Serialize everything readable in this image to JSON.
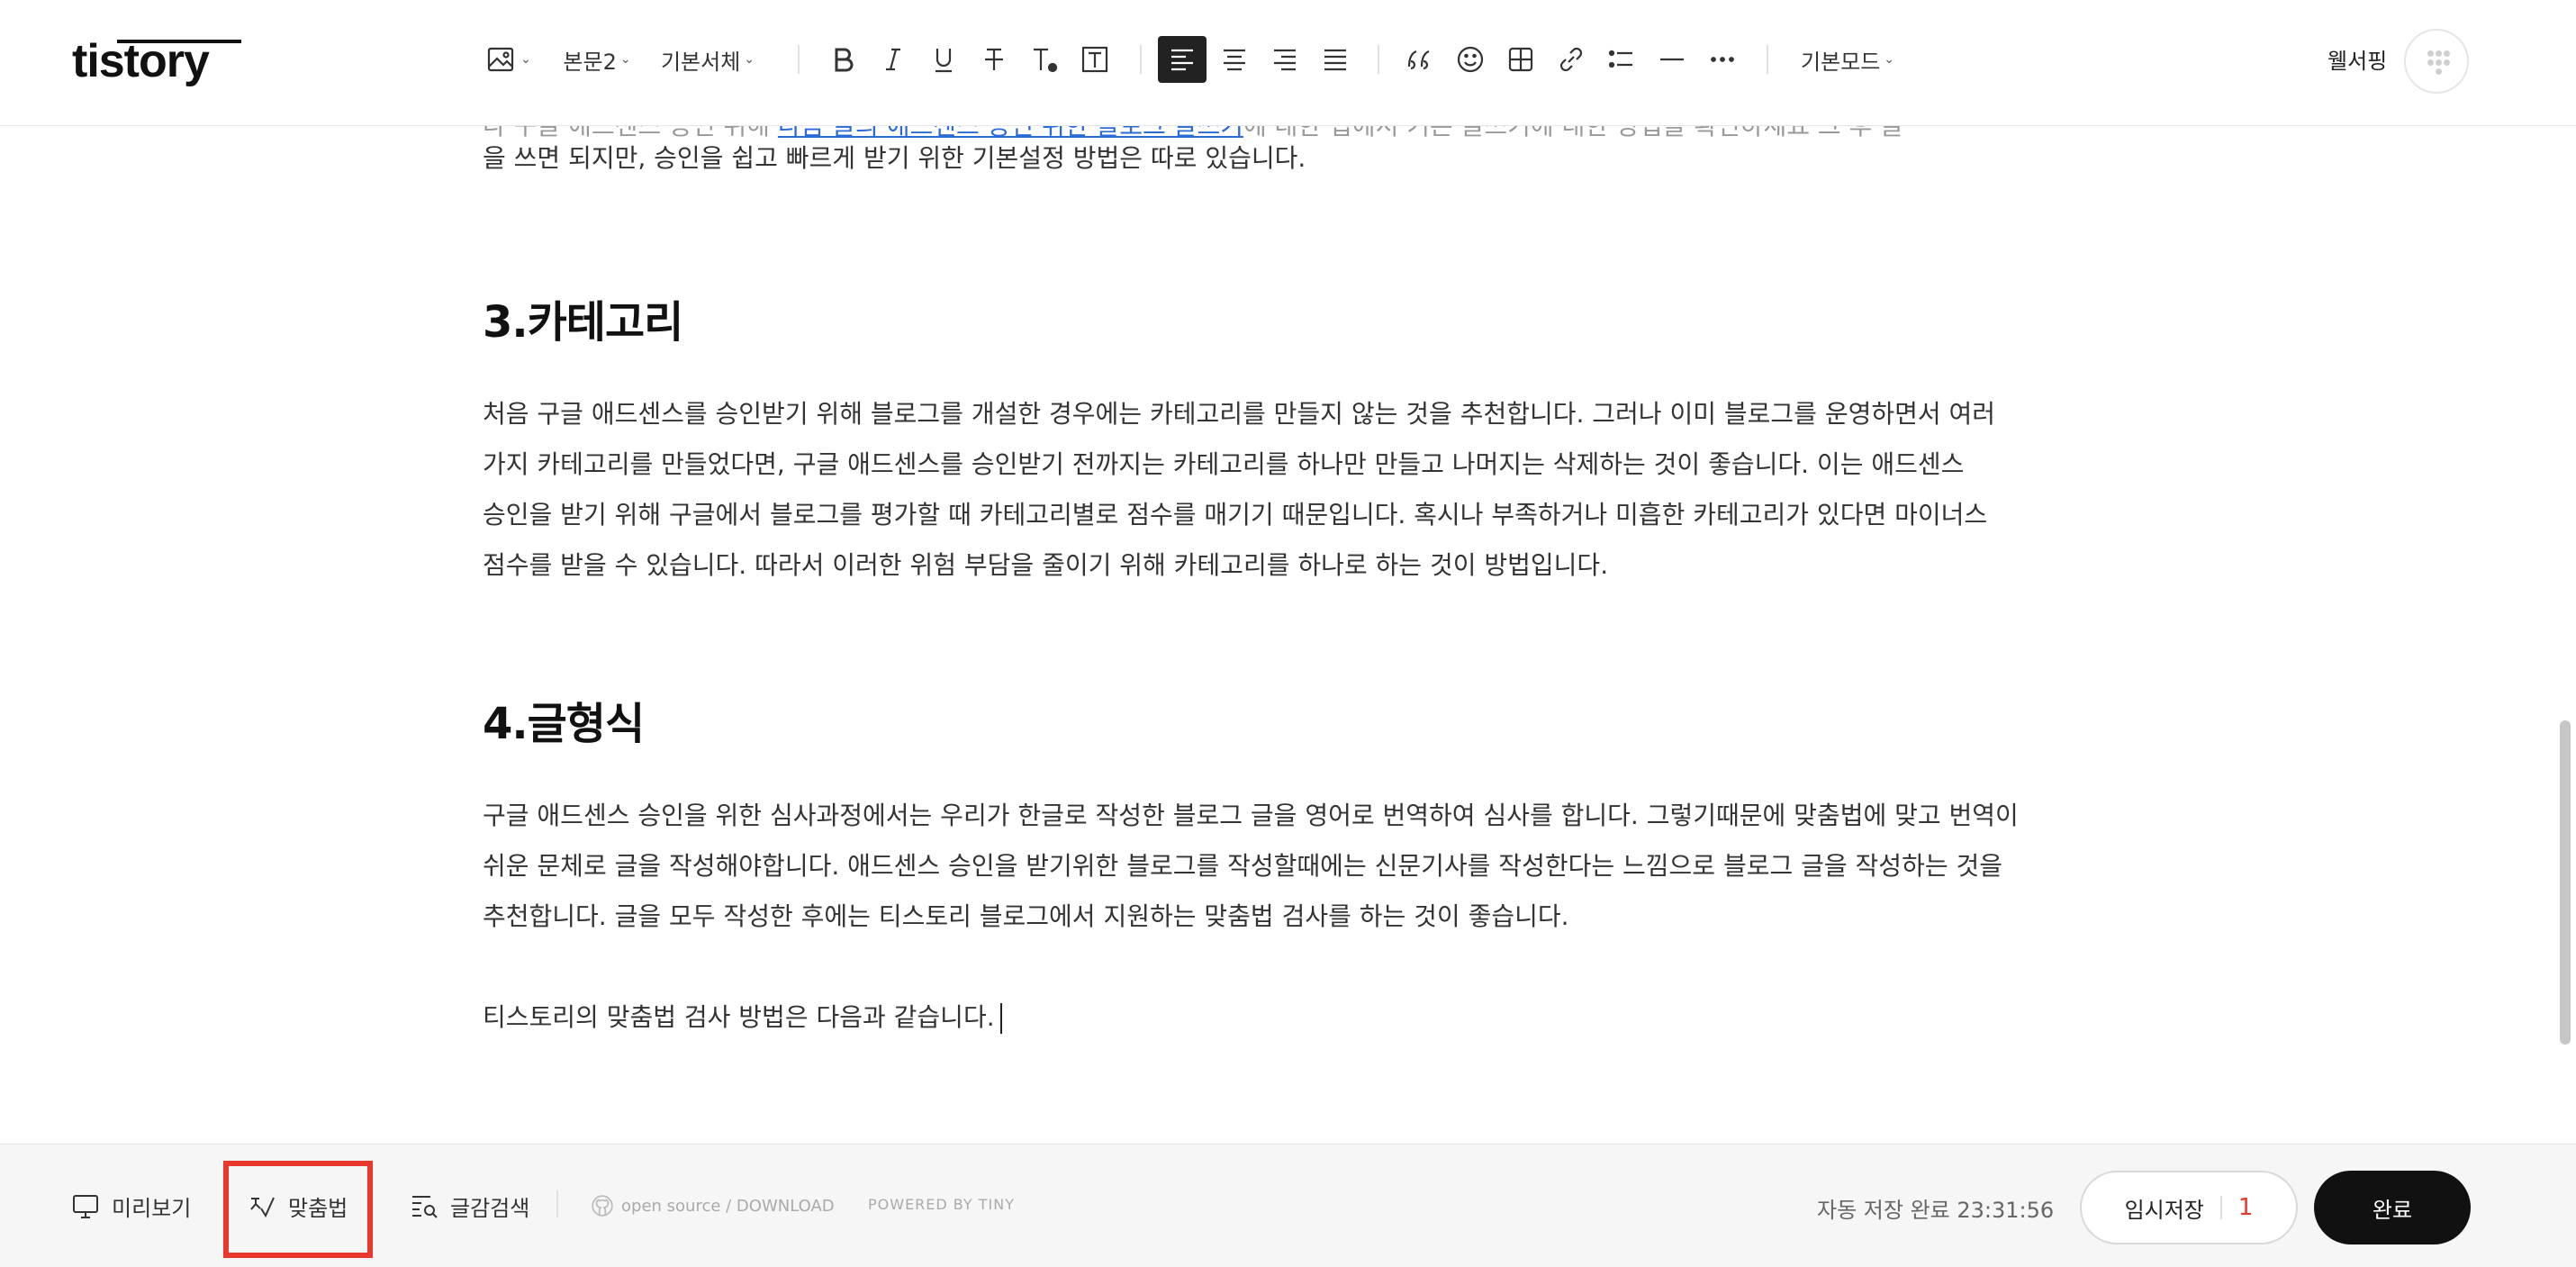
{
  "logo": "tistory",
  "toolbar": {
    "paragraph_style": "본문2",
    "font_family": "기본서체",
    "mode": "기본모드",
    "username": "웰서핑"
  },
  "content": {
    "prev_cut_line_left": "다 구글 애드센스 승인 위해 ",
    "prev_cut_line_link": "다음 글의 애드센스 승인 위한 블로그 글쓰기",
    "prev_cut_line_right": "에 대한 팁에서 기본 글쓰기에 대한 방법을 확인하세요 그 후 글",
    "prev_last_line": "을 쓰면 되지만, 승인을 쉽고 빠르게 받기 위한 기본설정 방법은 따로 있습니다.",
    "section3_title": "3.카테고리",
    "section3_body": "처음 구글 애드센스를 승인받기 위해 블로그를 개설한 경우에는 카테고리를 만들지 않는 것을 추천합니다. 그러나 이미 블로그를 운영하면서 여러 가지 카테고리를 만들었다면, 구글 애드센스를 승인받기 전까지는 카테고리를 하나만 만들고 나머지는 삭제하는 것이 좋습니다. 이는 애드센스 승인을 받기 위해 구글에서 블로그를 평가할 때 카테고리별로 점수를 매기기 때문입니다. 혹시나 부족하거나 미흡한 카테고리가 있다면 마이너스 점수를 받을 수 있습니다. 따라서 이러한 위험 부담을 줄이기 위해 카테고리를 하나로 하는 것이 방법입니다.",
    "section4_title": "4.글형식",
    "section4_body": "구글 애드센스 승인을 위한 심사과정에서는 우리가 한글로 작성한 블로그 글을 영어로 번역하여 심사를 합니다. 그렇기때문에 맞춤법에 맞고 번역이 쉬운 문체로 글을 작성해야합니다. 애드센스 승인을 받기위한 블로그를 작성할때에는 신문기사를 작성한다는 느낌으로 블로그 글을 작성하는 것을 추천합니다. 글을 모두 작성한 후에는 티스토리 블로그에서 지원하는 맞춤법 검사를 하는 것이 좋습니다.",
    "last_line": "티스토리의 맞춤법 검사 방법은 다음과 같습니다."
  },
  "bottom": {
    "preview": "미리보기",
    "spellcheck": "맞춤법",
    "search": "글감검색",
    "opensource": "open source / DOWNLOAD",
    "powered": "POWERED BY TINY",
    "autosave": "자동 저장 완료 23:31:56",
    "draft": "임시저장",
    "draft_count": "1",
    "done": "완료"
  },
  "colors": {
    "highlight": "#e8372c",
    "link": "#2a6bd8",
    "done_bg": "#111111"
  },
  "icons": [
    "image-icon",
    "bold-icon",
    "italic-icon",
    "underline-icon",
    "strikethrough-icon",
    "text-color-icon",
    "text-background-icon",
    "align-left-icon",
    "align-center-icon",
    "align-right-icon",
    "align-justify-icon",
    "quote-icon",
    "emoji-icon",
    "table-icon",
    "link-icon",
    "list-icon",
    "divider-icon",
    "more-icon",
    "monitor-icon",
    "spellcheck-icon",
    "search-doc-icon"
  ]
}
